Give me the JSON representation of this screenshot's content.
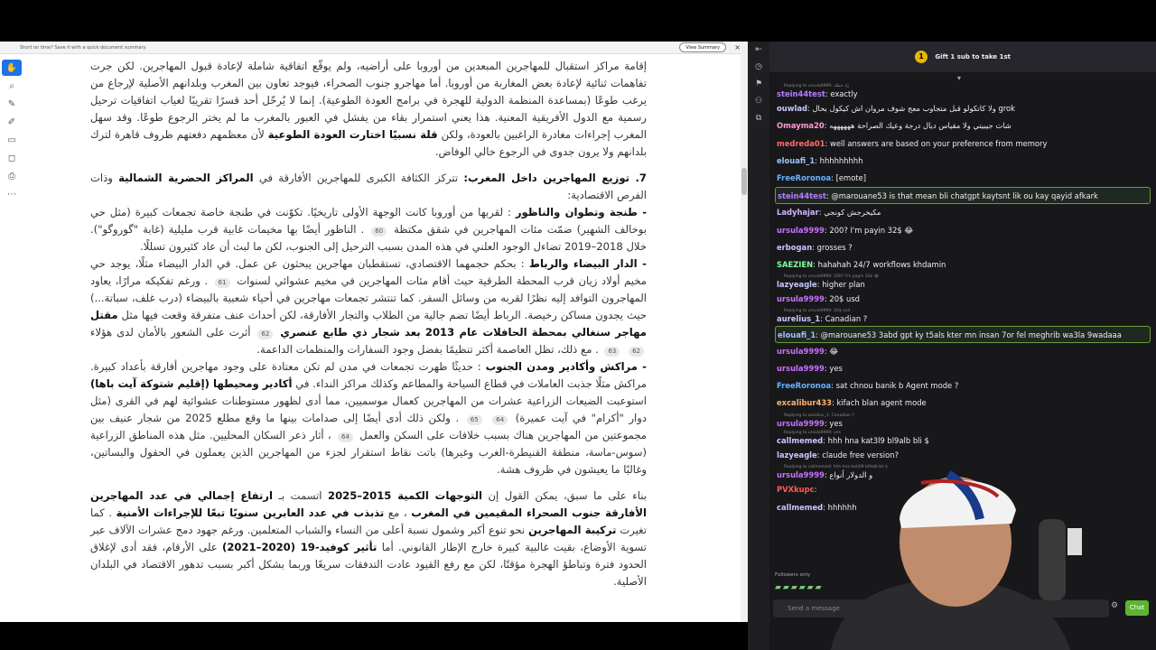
{
  "notice": {
    "text": "Short on time? Save it with a quick document summary.",
    "button": "View Summary",
    "close": "×"
  },
  "toolbar": [
    "hand-icon",
    "zoom-icon",
    "highlight-icon",
    "pen-icon",
    "comment-icon",
    "shape-icon",
    "stamp-icon",
    "more-icon"
  ],
  "doc": {
    "p0": "إقامة مراكز استقبال للمهاجرين المبعدين من أوروبا على أراضيه، ولم يوقّع اتفاقية شاملة لإعادة قبول المهاجرين. لكن جرت تفاهمات ثنائية لإعادة بعض المغاربة من أوروبا. أما مهاجرو جنوب الصحراء، فيوجد تعاون بين المغرب وبلدانهم الأصلية لإرجاع من يرغب طوعًا (بمساعدة المنظمة الدولية للهجرة في برامج العودة الطوعية). إنما لا يُرحّل أحد قسرًا تقريبًا لغياب اتفاقيات ترحيل رسمية مع الدول الأفريقية المعنية. هذا يعني استمرار بقاء من يفشل في العبور بالمغرب ما لم يختر الرجوع طوعًا. وقد سهل المغرب إجراءات مغادرة الراغبين بالعودة، ولكن",
    "p0_bold": "قلة نسبيًا اختارت العودة الطوعية",
    "p0_end": "لأن معظمهم دفعتهم ظروف قاهرة لترك بلدانهم ولا يرون جدوى في الرجوع خالي الوفاض.",
    "s7_title": "7. توزيع المهاجرين داخل المغرب:",
    "s7_a": "تتركز الكثافة الكبرى للمهاجرين الأفارقة في",
    "s7_bold": "المراكز الحضرية الشمالية",
    "s7_b": "وذات الفرص الاقتصادية:",
    "t1_title": "- طنجة وتطوان والناظور",
    "t1": ": لقربها من أوروبا كانت الوجهة الأولى تاريخيًا. تكوّنت في طنجة خاصة تجمعات كبيرة (مثل حي بوخالف الشهير) ضمّت مئات المهاجرين في شقق مكتظة",
    "ref60": "60",
    "t1b": ". الناظور أيضًا بها مخيمات غابية قرب مليلية (غابة \"گوروگو\"). خلال 2018–2019 تضاءل الوجود العلني في هذه المدن بسبب الترحيل إلى الجنوب، لكن ما لبث أن عاد كثيرون تسللًا.",
    "t2_title": "- الدار البيضاء والرباط",
    "t2": ": بحكم حجمهما الاقتصادي، تستقطبان مهاجرين يبحثون عن عمل. في الدار البيضاء مثلًا، يوجد حي مخيم أولاد زيان قرب المحطة الطرقية حيث أقام مئات المهاجرين في مخيم عشوائي لسنوات",
    "ref61": "61",
    "t2b": ". ورغم تفكيكه مرارًا، يعاود المهاجرون التوافد إليه نظرًا لقربه من وسائل السفر. كما تنتشر تجمعات مهاجرين في أحياء شعبية بالبيضاء (درب غلف، سباتة...) حيث يجدون مساكن رخيصة. الرباط أيضًا تضم جالية من الطلاب والتجار الأفارقة، لكن أحداث عنف متفرقة وقعت فيها مثل",
    "t2_bold": "مقتل مهاجر سنغالي بمحطة الحافلات عام 2013 بعد شجار ذي طابع عنصري",
    "ref62": "62",
    "t2c": "أثرت على الشعور بالأمان لدى هؤلاء",
    "ref62b": "62",
    "ref63": "63",
    "t2d": ". مع ذلك، تظل العاصمة أكثر تنظيمًا بفضل وجود السفارات والمنظمات الداعمة.",
    "t3_title": "- مراكش وأكادير ومدن الجنوب",
    "t3": ": حديثًا ظهرت تجمعات في مدن لم تكن معتادة على وجود مهاجرين أفارقة بأعداد كبيرة. مراكش مثلًا جذبت العاملات في قطاع السياحة والمطاعم وكذلك مراكز النداء. في",
    "t3_bold": "أكادير ومحيطها (إقليم شتوكة آيت باها)",
    "t3b": "استوعبت الضيعات الزراعية عشرات من المهاجرين كعمال موسميين، مما أدى لظهور مستوطنات عشوائية لهم في القرى (مثل دوار \"أكرام\" في آيت عميرة)",
    "ref64": "64",
    "ref65": "65",
    "t3c": ". ولكن ذلك أدى أيضًا إلى صدامات بينها ما وقع مطلع 2025 من شجار عنيف بين مجموعتين من المهاجرين هناك بسبب خلافات على السكن والعمل",
    "ref64b": "64",
    "t3d": "، أثار ذعر السكان المحليين. مثل هذه المناطق الزراعية (سوس-ماسة، منطقة القنيطرة-الغرب وغيرها) باتت نقاط استقرار لجزء من المهاجرين الذين يعملون في الحقول والبساتين، وغالبًا ما يعيشون في ظروف هشة.",
    "c_a": "بناء على ما سبق، يمكن القول إن",
    "c_bold1": "التوجهات الكمية 2015–2025",
    "c_b": "اتسمت بـ",
    "c_bold2": "ارتفاع إجمالي في عدد المهاجرين الأفارقة جنوب الصحراء المقيمين في المغرب",
    "c_c": "، مع",
    "c_bold3": "تذبذب في عدد العابرين سنويًا تبعًا للإجراءات الأمنية",
    "c_d": ". كما تغيرت",
    "c_bold4": "تركيبة المهاجرين",
    "c_e": "نحو تنوع أكبر وشمول نسبة أعلى من النساء والشباب المتعلمين. ورغم جهود دمج عشرات الآلاف عبر تسوية الأوضاع، بقيت غالبية كبيرة خارج الإطار القانوني. أما",
    "c_bold5": "تأثير كوفيد-19 (2020–2021)",
    "c_f": "على الأرقام، فقد أدى لإغلاق الحدود فترة وتباطؤ الهجرة مؤقتًا، لكن مع رفع القيود عادت التدفقات سريعًا وربما بشكل أكبر بسبب تدهور الاقتصاد في البلدان الأصلية."
  },
  "chat": {
    "gift_label": "Gift 1 sub to take 1st",
    "gift_count": "1",
    "input_placeholder": "Send a message",
    "chat_button": "Chat",
    "followers_only": "Followers only",
    "messages": [
      {
        "reply": "Replying to ursula9999: زاد حطك",
        "user": "stein44test",
        "color": "#b47dff",
        "text": "exactly"
      },
      {
        "user": "ouwlad",
        "color": "#c7c7ff",
        "text": "ولا كاتكولو قبل متجاوب معج شوف مروان اش كيكول بحال grok"
      },
      {
        "user": "Omayma20",
        "color": "#ff9ad1",
        "text": "شات جيبيتي ولا مقياس ديال درجة وعيك الصراحة ههههههه"
      },
      {
        "user": "medreda01",
        "color": "#ff6b6b",
        "text": "well answers are based on your preference from memory"
      },
      {
        "user": "elouafi_1",
        "color": "#9ec3ff",
        "text": "hhhhhhhhh"
      },
      {
        "user": "FreeRoronoa",
        "color": "#66b3ff",
        "text": "[emote]"
      },
      {
        "user": "stein44test",
        "color": "#b47dff",
        "text": "@marouane53 is that mean bli chatgpt kaytsnt lik ou kay qayid afkark",
        "hl": true
      },
      {
        "user": "Ladyhajar",
        "color": "#d0b6ff",
        "text": "مكيخرجش كونجي"
      },
      {
        "user": "ursula9999",
        "color": "#c970ff",
        "text": "200? I'm payin 32$ 😂"
      },
      {
        "user": "erbogan",
        "color": "#c7c7ff",
        "text": "grosses ?"
      },
      {
        "user": "SAEZIEN",
        "color": "#7fffa0",
        "text": "hahahah 24/7 workflows khdamin"
      },
      {
        "reply": "Replying to ursula9999: 200? I'm payin 32$ 😂",
        "user": "lazyeagle",
        "color": "#c7c7ff",
        "text": "higher plan"
      },
      {
        "user": "ursula9999",
        "color": "#c970ff",
        "text": "20$ usd"
      },
      {
        "reply": "Replying to ursula9999: 20$ usd",
        "user": "aurelius_1",
        "color": "#c7c7ff",
        "text": "Canadian ?"
      },
      {
        "user": "elouafi_1",
        "color": "#9ec3ff",
        "text": "@marouane53 3abd gpt ky t5als kter mn insan 7or fel meghrib wa3la 9wadaaa",
        "hl": true
      },
      {
        "user": "ursula9999",
        "color": "#c970ff",
        "text": "😂"
      },
      {
        "user": "ursula9999",
        "color": "#c970ff",
        "text": "yes"
      },
      {
        "user": "FreeRoronoa",
        "color": "#66b3ff",
        "text": "sat chnou banik b Agent mode ?"
      },
      {
        "user": "excalibur433",
        "color": "#ffb36b",
        "text": "kifach blan agent mode"
      },
      {
        "reply": "Replying to aurelius_1: Canadian ?",
        "user": "ursula9999",
        "color": "#c970ff",
        "text": "yes"
      },
      {
        "reply": "Replying to ursula9999: yes",
        "user": "callmemed",
        "color": "#c7c7ff",
        "text": "hhh hna kat3l9 bl9alb bli $"
      },
      {
        "user": "lazyeagle",
        "color": "#c7c7ff",
        "text": "claude free version?"
      },
      {
        "reply": "Replying to callmemed: hhh hna kat3l9 bl9alb bli $",
        "user": "ursula9999",
        "color": "#c970ff",
        "text": "و الدولار أنواع"
      },
      {
        "user": "PVXkupc",
        "color": "#ff5a5a",
        "text": ""
      },
      {
        "user": "callmemed",
        "color": "#c7c7ff",
        "text": "hhhhhh"
      }
    ]
  }
}
